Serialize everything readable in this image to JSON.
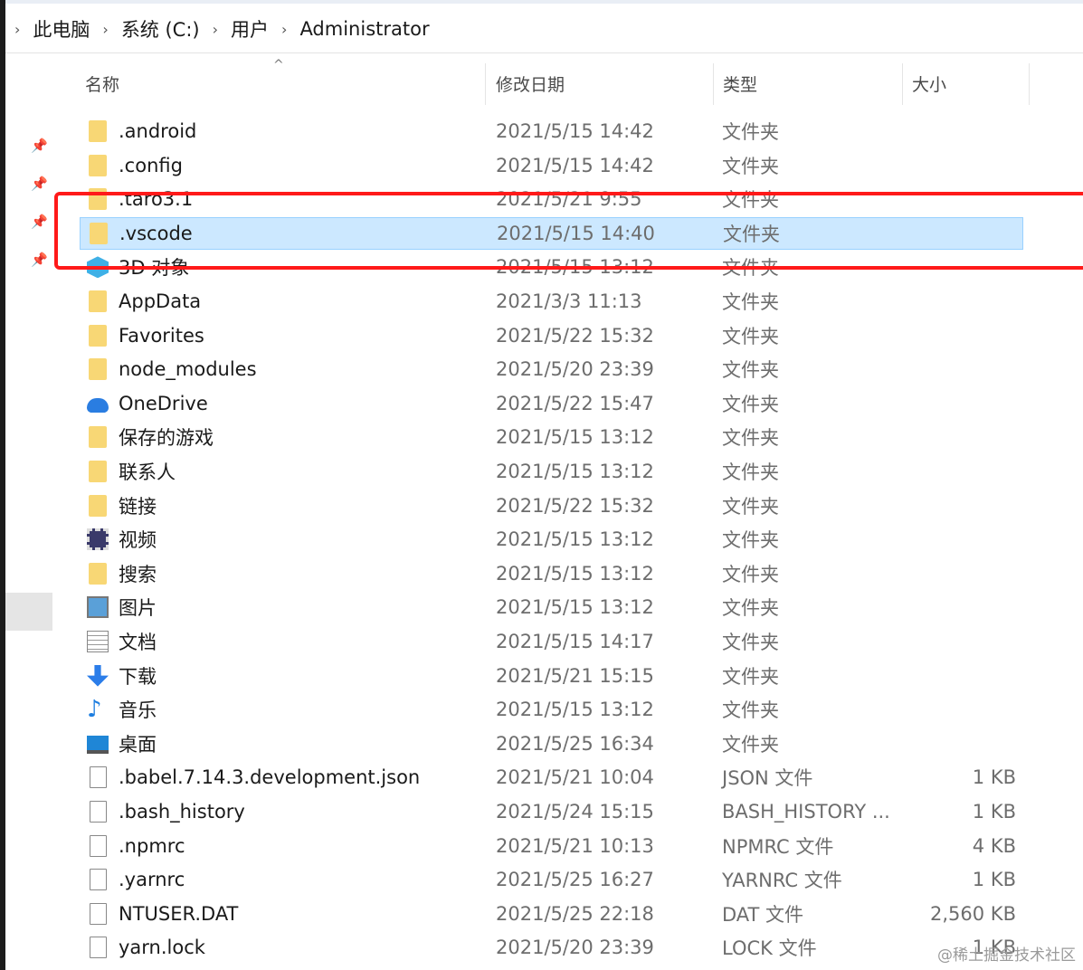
{
  "breadcrumb": {
    "items": [
      "此电脑",
      "系统 (C:)",
      "用户",
      "Administrator"
    ],
    "separator": "›"
  },
  "columns": {
    "name": "名称",
    "date": "修改日期",
    "type": "类型",
    "size": "大小"
  },
  "rows": [
    {
      "name": ".android",
      "date": "2021/5/15 14:42",
      "type": "文件夹",
      "size": "",
      "icon": "folder-icon"
    },
    {
      "name": ".config",
      "date": "2021/5/15 14:42",
      "type": "文件夹",
      "size": "",
      "icon": "folder-icon"
    },
    {
      "name": ".taro3.1",
      "date": "2021/5/21 9:55",
      "type": "文件夹",
      "size": "",
      "icon": "folder-icon"
    },
    {
      "name": ".vscode",
      "date": "2021/5/15 14:40",
      "type": "文件夹",
      "size": "",
      "icon": "folder-icon",
      "selected": true
    },
    {
      "name": "3D 对象",
      "date": "2021/5/15 13:12",
      "type": "文件夹",
      "size": "",
      "icon": "3d-objects-icon"
    },
    {
      "name": "AppData",
      "date": "2021/3/3 11:13",
      "type": "文件夹",
      "size": "",
      "icon": "folder-icon"
    },
    {
      "name": "Favorites",
      "date": "2021/5/22 15:32",
      "type": "文件夹",
      "size": "",
      "icon": "folder-icon"
    },
    {
      "name": "node_modules",
      "date": "2021/5/20 23:39",
      "type": "文件夹",
      "size": "",
      "icon": "folder-icon"
    },
    {
      "name": "OneDrive",
      "date": "2021/5/22 15:47",
      "type": "文件夹",
      "size": "",
      "icon": "cloud-icon"
    },
    {
      "name": "保存的游戏",
      "date": "2021/5/15 13:12",
      "type": "文件夹",
      "size": "",
      "icon": "saved-games-icon"
    },
    {
      "name": "联系人",
      "date": "2021/5/15 13:12",
      "type": "文件夹",
      "size": "",
      "icon": "contacts-icon"
    },
    {
      "name": "链接",
      "date": "2021/5/22 15:32",
      "type": "文件夹",
      "size": "",
      "icon": "links-icon"
    },
    {
      "name": "视频",
      "date": "2021/5/15 13:12",
      "type": "文件夹",
      "size": "",
      "icon": "video-icon"
    },
    {
      "name": "搜索",
      "date": "2021/5/15 13:12",
      "type": "文件夹",
      "size": "",
      "icon": "search-folder-icon"
    },
    {
      "name": "图片",
      "date": "2021/5/15 13:12",
      "type": "文件夹",
      "size": "",
      "icon": "pictures-icon"
    },
    {
      "name": "文档",
      "date": "2021/5/15 14:17",
      "type": "文件夹",
      "size": "",
      "icon": "documents-icon"
    },
    {
      "name": "下载",
      "date": "2021/5/21 15:15",
      "type": "文件夹",
      "size": "",
      "icon": "download-icon"
    },
    {
      "name": "音乐",
      "date": "2021/5/15 13:12",
      "type": "文件夹",
      "size": "",
      "icon": "music-icon"
    },
    {
      "name": "桌面",
      "date": "2021/5/25 16:34",
      "type": "文件夹",
      "size": "",
      "icon": "desktop-icon"
    },
    {
      "name": ".babel.7.14.3.development.json",
      "date": "2021/5/21 10:04",
      "type": "JSON 文件",
      "size": "1 KB",
      "icon": "file-icon"
    },
    {
      "name": ".bash_history",
      "date": "2021/5/24 15:15",
      "type": "BASH_HISTORY ...",
      "size": "1 KB",
      "icon": "file-icon"
    },
    {
      "name": ".npmrc",
      "date": "2021/5/21 10:13",
      "type": "NPMRC 文件",
      "size": "4 KB",
      "icon": "file-icon"
    },
    {
      "name": ".yarnrc",
      "date": "2021/5/25 16:27",
      "type": "YARNRC 文件",
      "size": "1 KB",
      "icon": "file-icon"
    },
    {
      "name": "NTUSER.DAT",
      "date": "2021/5/25 22:18",
      "type": "DAT 文件",
      "size": "2,560 KB",
      "icon": "file-icon"
    },
    {
      "name": "yarn.lock",
      "date": "2021/5/20 23:39",
      "type": "LOCK 文件",
      "size": "1 KB",
      "icon": "file-icon"
    }
  ],
  "watermark": "@稀土掘金技术社区",
  "colors": {
    "selection": "#cce8ff",
    "highlight_box": "#ff1a1a",
    "folder": "#f8d775"
  }
}
